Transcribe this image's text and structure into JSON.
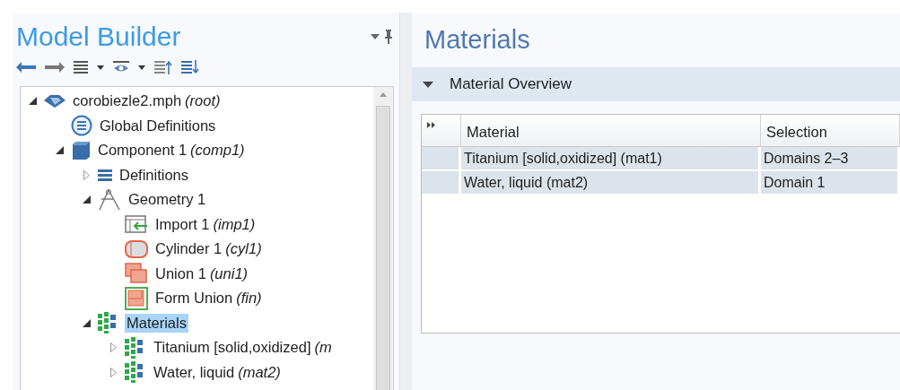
{
  "model_builder": {
    "title": "Model Builder",
    "tree": [
      {
        "label": "corobiezle2.mph",
        "note": "(root)",
        "kind": "file",
        "expanded": true,
        "selected": false,
        "children": [
          {
            "label": "Global Definitions",
            "kind": "global",
            "selected": false
          },
          {
            "label": "Component 1",
            "note": "(comp1)",
            "kind": "component",
            "expanded": true,
            "selected": false,
            "children": [
              {
                "label": "Definitions",
                "kind": "definitions",
                "expanded": false,
                "selected": false
              },
              {
                "label": "Geometry 1",
                "kind": "geometry",
                "expanded": true,
                "selected": false,
                "children": [
                  {
                    "label": "Import 1",
                    "note": "(imp1)",
                    "kind": "import",
                    "selected": false
                  },
                  {
                    "label": "Cylinder 1",
                    "note": "(cyl1)",
                    "kind": "cylinder",
                    "selected": false
                  },
                  {
                    "label": "Union 1",
                    "note": "(uni1)",
                    "kind": "union",
                    "selected": false
                  },
                  {
                    "label": "Form Union",
                    "note": "(fin)",
                    "kind": "form-union",
                    "selected": false
                  }
                ]
              },
              {
                "label": "Materials",
                "kind": "materials",
                "expanded": true,
                "selected": true,
                "children": [
                  {
                    "label": "Titanium [solid,oxidized]",
                    "note": "(m",
                    "kind": "material",
                    "expanded": false,
                    "selected": false
                  },
                  {
                    "label": "Water, liquid",
                    "note": "(mat2)",
                    "kind": "material",
                    "expanded": false,
                    "selected": false
                  }
                ]
              }
            ]
          }
        ]
      }
    ]
  },
  "materials": {
    "title": "Materials",
    "section": {
      "title": "Material Overview",
      "expanded": true
    },
    "table": {
      "columns": [
        "Material",
        "Selection"
      ],
      "rows": [
        {
          "cells": [
            "Titanium [solid,oxidized] (mat1)",
            "Domains 2–3"
          ]
        },
        {
          "cells": [
            "Water, liquid (mat2)",
            "Domain 1"
          ]
        }
      ]
    }
  }
}
